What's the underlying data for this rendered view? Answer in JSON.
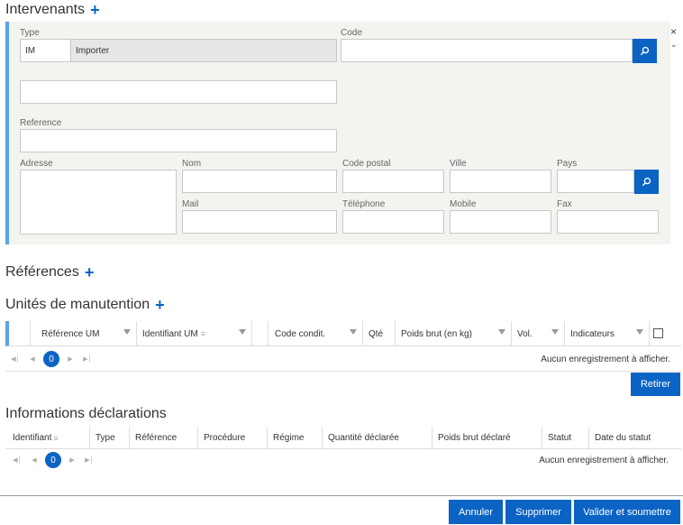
{
  "intervenants": {
    "title": "Intervenants",
    "add": "+",
    "close": "×",
    "type_label": "Type",
    "type_code": "IM",
    "type_value": "Importer",
    "code_label": "Code",
    "code_value": "",
    "blank_value": "",
    "reference_label": "Reference",
    "reference_value": "",
    "adresse_label": "Adresse",
    "nom_label": "Nom",
    "code_postal_label": "Code postal",
    "ville_label": "Ville",
    "pays_label": "Pays",
    "mail_label": "Mail",
    "telephone_label": "Téléphone",
    "mobile_label": "Mobile",
    "fax_label": "Fax"
  },
  "references": {
    "title": "Références",
    "add": "+"
  },
  "unites": {
    "title": "Unités de manutention",
    "add": "+",
    "columns": [
      "Référence UM",
      "Identifiant UM",
      "Code condit.",
      "Qté",
      "Poids brut (en kg)",
      "Vol.",
      "Indicateurs"
    ],
    "page": "0",
    "empty": "Aucun enregistrement à afficher.",
    "retirer": "Retirer"
  },
  "declarations": {
    "title": "Informations déclarations",
    "columns": [
      "Identifiant",
      "Type",
      "Référence",
      "Procédure",
      "Régime",
      "Quantité déclarée",
      "Poids brut déclaré",
      "Statut",
      "Date du statut"
    ],
    "page": "0",
    "empty": "Aucun enregistrement à afficher."
  },
  "footer": {
    "annuler": "Annuler",
    "supprimer": "Supprimer",
    "valider": "Valider et soumettre"
  },
  "colors": {
    "accent": "#0b63c4",
    "panel_border": "#5aa3ea",
    "panel_bg": "#f3f3ef"
  }
}
